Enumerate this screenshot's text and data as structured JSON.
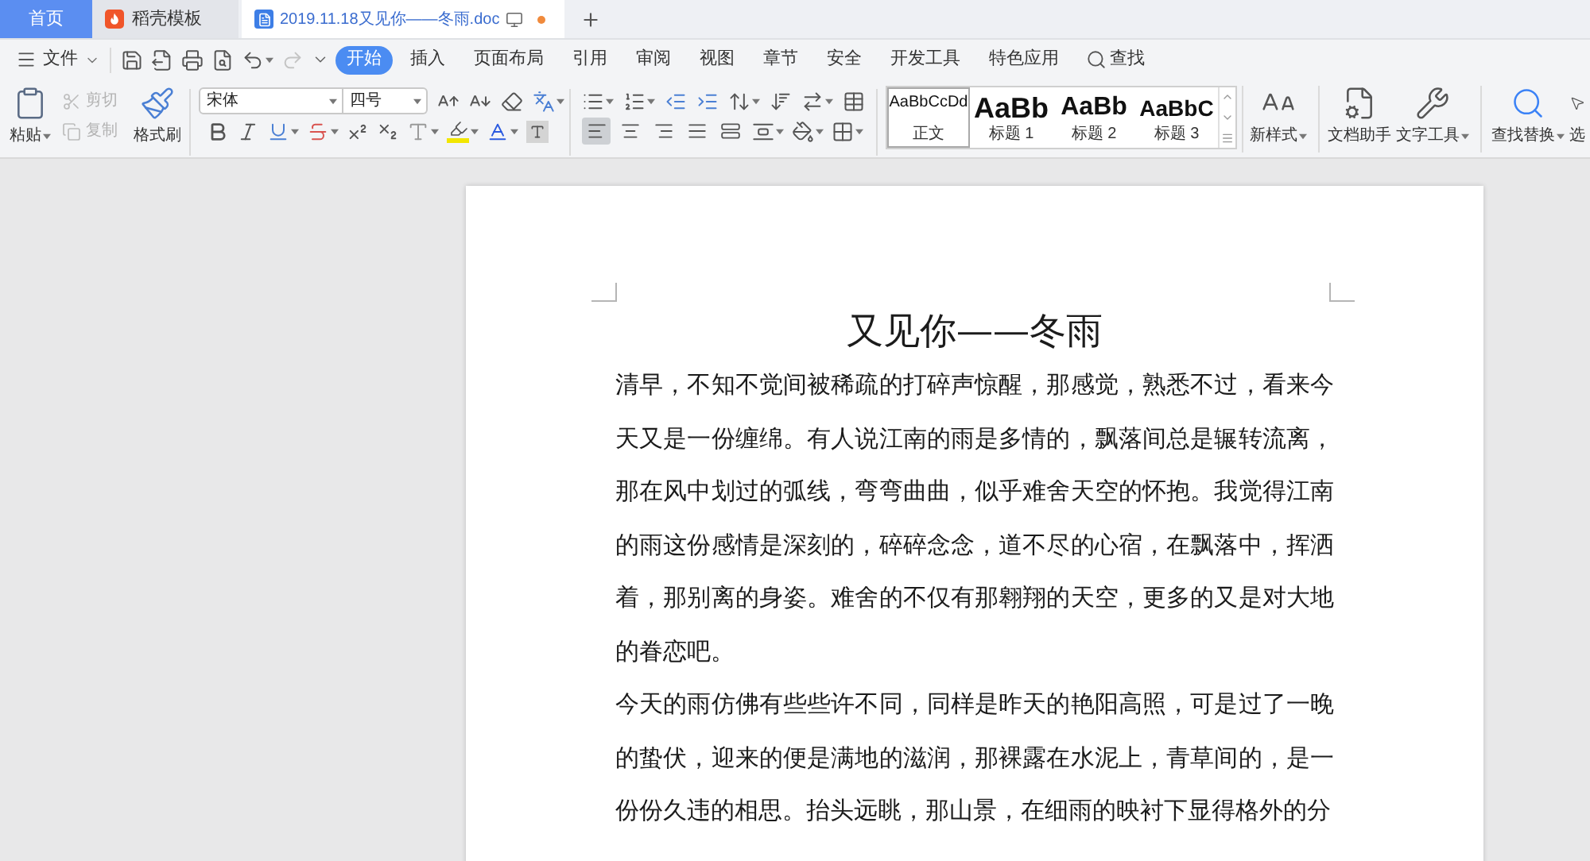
{
  "tabs": [
    {
      "label": "首页",
      "kind": "home",
      "selected": false
    },
    {
      "label": "稻壳模板",
      "kind": "template",
      "selected": false
    },
    {
      "label": "2019.11.18又见你——冬雨.doc",
      "kind": "document",
      "selected": true,
      "modified": true
    }
  ],
  "menu": {
    "file": "文件",
    "redo": {
      "disabled": true
    },
    "tabs": [
      {
        "label": "开始",
        "selected": true
      },
      {
        "label": "插入",
        "selected": false
      },
      {
        "label": "页面布局",
        "selected": false
      },
      {
        "label": "引用",
        "selected": false
      },
      {
        "label": "审阅",
        "selected": false
      },
      {
        "label": "视图",
        "selected": false
      },
      {
        "label": "章节",
        "selected": false
      },
      {
        "label": "安全",
        "selected": false
      },
      {
        "label": "开发工具",
        "selected": false
      },
      {
        "label": "特色应用",
        "selected": false
      }
    ],
    "search": "查找"
  },
  "ribbon": {
    "paste": "粘贴",
    "cut": {
      "label": "剪切",
      "disabled": true
    },
    "copy": {
      "label": "复制",
      "disabled": true
    },
    "format_painter": "格式刷",
    "font_family": "宋体",
    "font_size": "四号",
    "alignments": [
      {
        "kind": "left",
        "selected": true
      },
      {
        "kind": "center",
        "selected": false
      },
      {
        "kind": "right",
        "selected": false
      },
      {
        "kind": "justify",
        "selected": false
      },
      {
        "kind": "distributed",
        "selected": false
      }
    ],
    "styles": [
      {
        "kind": "body",
        "sample": "AaBbCcDd",
        "label": "正文",
        "selected": true
      },
      {
        "kind": "heading1",
        "sample": "AaBb",
        "label": "标题 1",
        "selected": false
      },
      {
        "kind": "heading2",
        "sample": "AaBb",
        "label": "标题 2",
        "selected": false
      },
      {
        "kind": "heading3",
        "sample": "AaBbC",
        "label": "标题 3",
        "selected": false
      }
    ],
    "tool_groups": [
      [
        {
          "kind": "new-style",
          "label": "新样式",
          "dropdown": true
        }
      ],
      [
        {
          "kind": "assistant",
          "label": "文档助手",
          "dropdown": false
        },
        {
          "kind": "text-tools",
          "label": "文字工具",
          "dropdown": true
        }
      ],
      [
        {
          "kind": "find-replace",
          "label": "查找替换",
          "dropdown": true
        },
        {
          "kind": "select",
          "label": "选",
          "dropdown": false
        }
      ]
    ]
  },
  "document": {
    "title": "又见你——冬雨",
    "paragraphs": [
      "清早，不知不觉间被稀疏的打碎声惊醒，那感觉，熟悉不过，看来今天又是一份缠绵。有人说江南的雨是多情的，飘落间总是辗转流离，那在风中划过的弧线，弯弯曲曲，似乎难舍天空的怀抱。我觉得江南的雨这份感情是深刻的，碎碎念念，道不尽的心宿，在飘落中，挥洒着，那别离的身姿。难舍的不仅有那翱翔的天空，更多的又是对大地的眷恋吧。",
      "今天的雨仿佛有些些许不同，同样是昨天的艳阳高照，可是过了一晚的蛰伏，迎来的便是满地的滋润，那裸露在水泥上，青草间的，是一份份久违的相思。抬头远眺，那山景，在细雨的映衬下显得格外的分"
    ]
  }
}
